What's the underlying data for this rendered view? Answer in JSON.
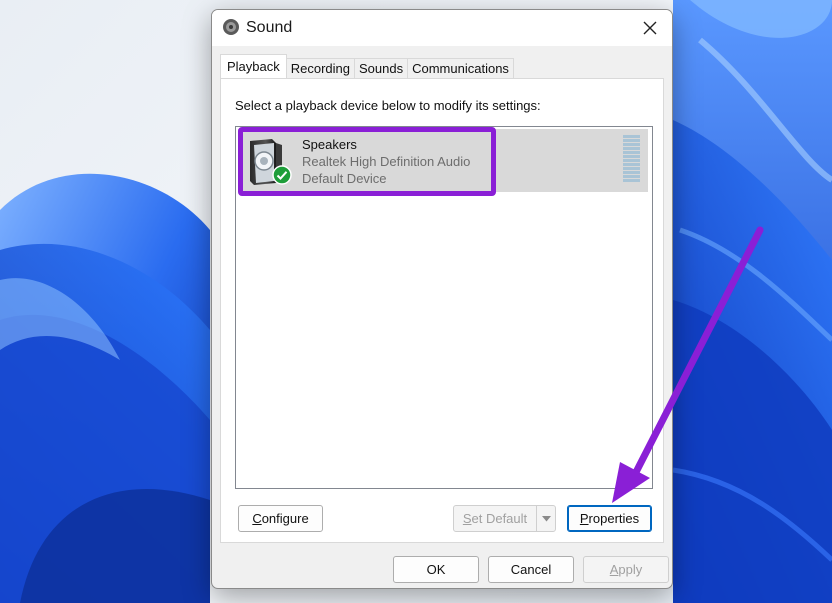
{
  "window": {
    "title": "Sound",
    "close_glyph": "✕"
  },
  "tabs": [
    {
      "label": "Playback",
      "active": true
    },
    {
      "label": "Recording",
      "active": false
    },
    {
      "label": "Sounds",
      "active": false
    },
    {
      "label": "Communications",
      "active": false
    }
  ],
  "playback": {
    "instruction": "Select a playback device below to modify its settings:",
    "devices": [
      {
        "name": "Speakers",
        "driver": "Realtek High Definition Audio",
        "status": "Default Device",
        "icon": "speaker-icon",
        "status_icon": "checkmark-badge-icon"
      }
    ]
  },
  "buttons": {
    "configure": {
      "prefix": "",
      "mnemonic": "C",
      "rest": "onfigure"
    },
    "set_default": {
      "prefix": "",
      "mnemonic": "S",
      "rest": "et Default",
      "disabled": true
    },
    "properties": {
      "prefix": "",
      "mnemonic": "P",
      "rest": "roperties",
      "focused": true
    },
    "ok": "OK",
    "cancel": "Cancel",
    "apply": {
      "prefix": "",
      "mnemonic": "A",
      "rest": "pply",
      "disabled": true
    }
  },
  "colors": {
    "highlight": "#8a1fd6",
    "arrow": "#8a1fd6",
    "focus": "#0067c0",
    "wallpaper_blue": "#1f5fe0"
  }
}
